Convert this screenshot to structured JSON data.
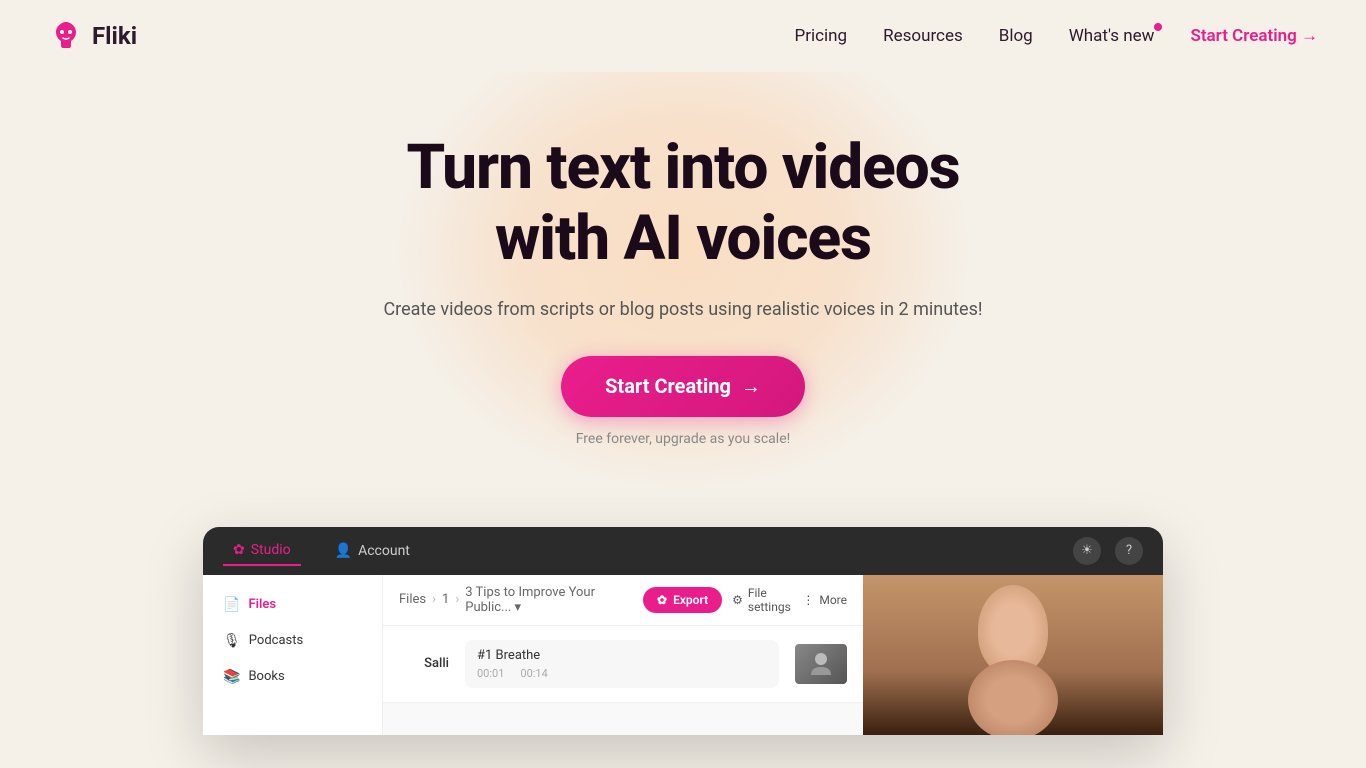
{
  "brand": {
    "logo_text": "Fliki",
    "logo_icon": "🌸"
  },
  "navbar": {
    "links": [
      {
        "id": "pricing",
        "label": "Pricing"
      },
      {
        "id": "resources",
        "label": "Resources"
      },
      {
        "id": "blog",
        "label": "Blog"
      },
      {
        "id": "whats-new",
        "label": "What's new",
        "has_dot": true
      }
    ],
    "cta_label": "Start Creating →"
  },
  "hero": {
    "title_line1": "Turn text into videos",
    "title_line2": "with AI voices",
    "subtitle": "Create videos from scripts or blog posts using realistic voices in 2 minutes!",
    "cta_label": "Start Creating",
    "cta_arrow": "→",
    "free_text": "Free forever, upgrade as you scale!"
  },
  "app_preview": {
    "tabs": [
      {
        "id": "studio",
        "label": "Studio",
        "icon": "✿",
        "active": true
      },
      {
        "id": "account",
        "label": "Account",
        "icon": "👤",
        "active": false
      }
    ],
    "breadcrumb": {
      "parts": [
        "Files",
        "1",
        "3 Tips to Improve Your Public..."
      ],
      "chevron": "▾"
    },
    "actions": {
      "export_label": "Export",
      "export_icon": "✿",
      "file_settings_label": "File settings",
      "file_settings_icon": "⚙",
      "more_label": "More",
      "more_icon": "⋮"
    },
    "sidebar_items": [
      {
        "id": "files",
        "label": "Files",
        "icon": "📄",
        "active": true
      },
      {
        "id": "podcasts",
        "label": "Podcasts",
        "icon": "🎙",
        "active": false
      },
      {
        "id": "books",
        "label": "Books",
        "icon": "📚",
        "active": false
      }
    ],
    "script_row": {
      "speaker": "Salli",
      "text": "#1 Breathe",
      "timecode_start": "00:01",
      "timecode_end": "00:14"
    },
    "topbar_icons": [
      "☀",
      "?"
    ]
  }
}
